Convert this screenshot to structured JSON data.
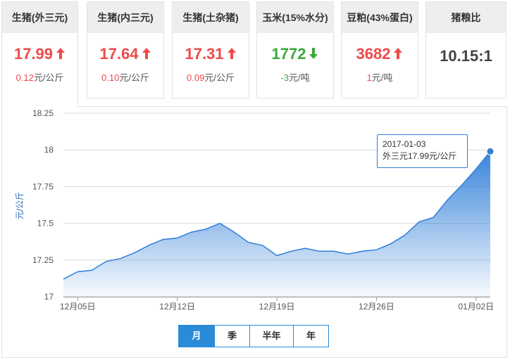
{
  "cards": [
    {
      "title": "生猪(外三元)",
      "value": "17.99",
      "trend": "up",
      "change": "0.12",
      "unit": "元/公斤"
    },
    {
      "title": "生猪(内三元)",
      "value": "17.64",
      "trend": "up",
      "change": "0.10",
      "unit": "元/公斤"
    },
    {
      "title": "生猪(土杂猪)",
      "value": "17.31",
      "trend": "up",
      "change": "0.09",
      "unit": "元/公斤"
    },
    {
      "title": "玉米(15%水分)",
      "value": "1772",
      "trend": "down",
      "change": "-3",
      "unit": "元/吨"
    },
    {
      "title": "豆粕(43%蛋白)",
      "value": "3682",
      "trend": "up",
      "change": "1",
      "unit": "元/吨"
    },
    {
      "title": "猪粮比",
      "value": "10.15:1",
      "trend": "flat",
      "change": "",
      "unit": ""
    }
  ],
  "colors": {
    "up": "#f04949",
    "down": "#3aa93a",
    "series": "#2f7ed8",
    "tab_active": "#2a8bd8"
  },
  "tooltip": {
    "date": "2017-01-03",
    "text": "外三元17.99元/公斤"
  },
  "range_tabs": [
    {
      "label": "月",
      "active": true
    },
    {
      "label": "季",
      "active": false
    },
    {
      "label": "半年",
      "active": false
    },
    {
      "label": "年",
      "active": false
    }
  ],
  "chart_data": {
    "type": "area",
    "title": "",
    "xlabel": "",
    "ylabel": "元/公斤",
    "ylim": [
      17,
      18.25
    ],
    "yticks": [
      17,
      17.25,
      17.5,
      17.75,
      18,
      18.25
    ],
    "ytick_labels": [
      "17",
      "17.25",
      "17.5",
      "17.75",
      "18",
      "18.25"
    ],
    "xtick_labels": [
      {
        "label": "12月05日",
        "x": "2016-12-05"
      },
      {
        "label": "12月12日",
        "x": "2016-12-12"
      },
      {
        "label": "12月19日",
        "x": "2016-12-19"
      },
      {
        "label": "12月26日",
        "x": "2016-12-26"
      },
      {
        "label": "01月02日",
        "x": "2017-01-02"
      }
    ],
    "grid": true,
    "legend": "none",
    "x": [
      "2016-12-04",
      "2016-12-05",
      "2016-12-06",
      "2016-12-07",
      "2016-12-08",
      "2016-12-09",
      "2016-12-10",
      "2016-12-11",
      "2016-12-12",
      "2016-12-13",
      "2016-12-14",
      "2016-12-15",
      "2016-12-16",
      "2016-12-17",
      "2016-12-18",
      "2016-12-19",
      "2016-12-20",
      "2016-12-21",
      "2016-12-22",
      "2016-12-23",
      "2016-12-24",
      "2016-12-25",
      "2016-12-26",
      "2016-12-27",
      "2016-12-28",
      "2016-12-29",
      "2016-12-30",
      "2016-12-31",
      "2017-01-01",
      "2017-01-02",
      "2017-01-03"
    ],
    "series": [
      {
        "values": [
          17.12,
          17.17,
          17.18,
          17.24,
          17.26,
          17.3,
          17.35,
          17.39,
          17.4,
          17.44,
          17.46,
          17.5,
          17.44,
          17.37,
          17.35,
          17.28,
          17.31,
          17.33,
          17.31,
          17.31,
          17.29,
          17.31,
          17.32,
          17.36,
          17.42,
          17.51,
          17.54,
          17.66,
          17.76,
          17.87,
          17.99
        ]
      }
    ]
  }
}
